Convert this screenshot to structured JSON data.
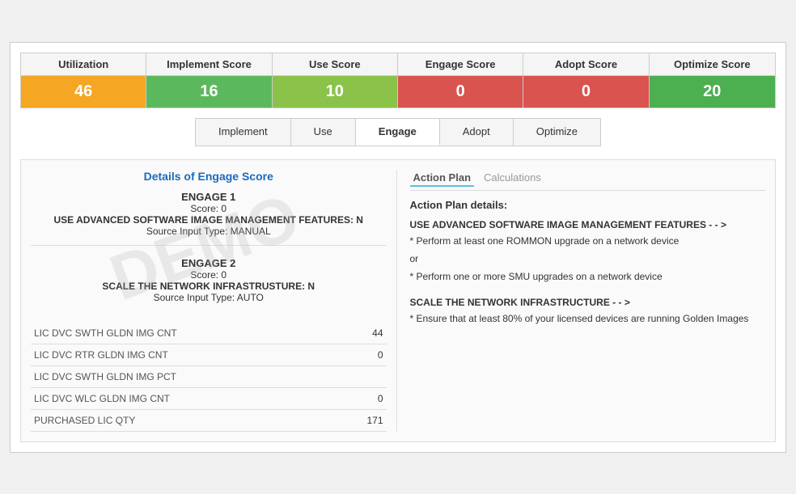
{
  "scoreHeader": {
    "cells": [
      {
        "label": "Utilization",
        "value": "46",
        "valueBg": "bg-orange"
      },
      {
        "label": "Implement Score",
        "value": "16",
        "valueBg": "bg-green"
      },
      {
        "label": "Use Score",
        "value": "10",
        "valueBg": "bg-yellow-green"
      },
      {
        "label": "Engage Score",
        "value": "0",
        "valueBg": "bg-red"
      },
      {
        "label": "Adopt Score",
        "value": "0",
        "valueBg": "bg-red"
      },
      {
        "label": "Optimize Score",
        "value": "20",
        "valueBg": "bg-bright-green"
      }
    ]
  },
  "tabs": [
    {
      "label": "Implement",
      "active": false
    },
    {
      "label": "Use",
      "active": false
    },
    {
      "label": "Engage",
      "active": true
    },
    {
      "label": "Adopt",
      "active": false
    },
    {
      "label": "Optimize",
      "active": false
    }
  ],
  "leftPanel": {
    "title": "Details of Engage Score",
    "engageBlocks": [
      {
        "name": "ENGAGE 1",
        "score": "Score: 0",
        "feature": "USE ADVANCED SOFTWARE IMAGE MANAGEMENT FEATURES: N",
        "source": "Source Input Type: MANUAL"
      },
      {
        "name": "ENGAGE 2",
        "score": "Score: 0",
        "feature": "SCALE THE NETWORK INFRASTRUSTURE: N",
        "source": "Source Input Type: AUTO"
      }
    ],
    "dataRows": [
      {
        "label": "LIC DVC SWTH GLDN IMG CNT",
        "value": "44"
      },
      {
        "label": "LIC DVC RTR GLDN IMG CNT",
        "value": "0"
      },
      {
        "label": "LIC DVC SWTH GLDN IMG PCT",
        "value": ""
      },
      {
        "label": "LIC DVC WLC GLDN IMG CNT",
        "value": "0"
      },
      {
        "label": "PURCHASED LIC QTY",
        "value": "171"
      }
    ]
  },
  "rightPanel": {
    "tabs": [
      {
        "label": "Action Plan",
        "active": true
      },
      {
        "label": "Calculations",
        "active": false
      }
    ],
    "actionPlanTitle": "Action Plan details:",
    "features": [
      {
        "title": "USE ADVANCED SOFTWARE IMAGE MANAGEMENT FEATURES - - >",
        "details": [
          "* Perform at least one ROMMON upgrade on a network device",
          "or",
          "* Perform one or more SMU upgrades on a network device"
        ]
      },
      {
        "title": "SCALE THE NETWORK INFRASTRUCTURE - - >",
        "details": [
          "* Ensure that at least 80% of your licensed devices are running Golden Images"
        ]
      }
    ]
  },
  "watermark": {
    "text": "DEMO"
  }
}
